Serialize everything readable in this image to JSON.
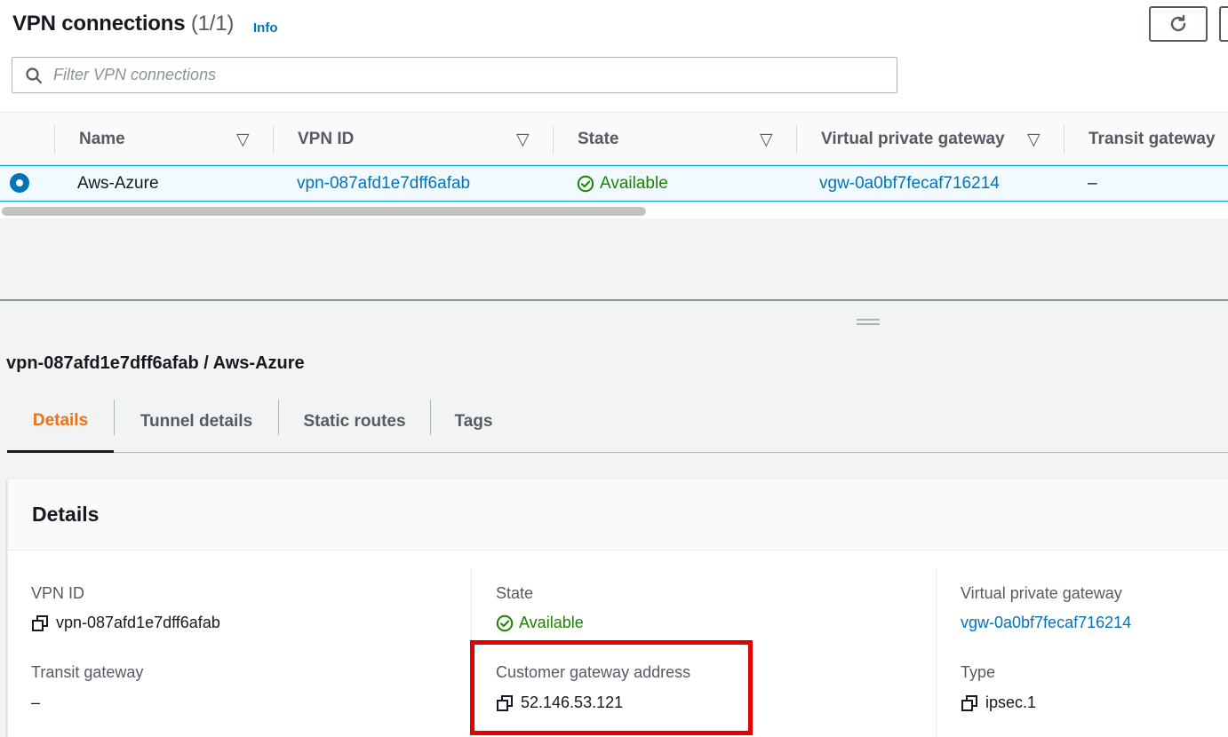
{
  "list": {
    "title": "VPN connections",
    "count": "(1/1)",
    "info_label": "Info",
    "filter_placeholder": "Filter VPN connections"
  },
  "table": {
    "columns": [
      "Name",
      "VPN ID",
      "State",
      "Virtual private gateway",
      "Transit gateway"
    ],
    "rows": [
      {
        "name": "Aws-Azure",
        "vpn_id": "vpn-087afd1e7dff6afab",
        "state": "Available",
        "vpg": "vgw-0a0bf7fecaf716214",
        "tgw": "–"
      }
    ]
  },
  "detail": {
    "title": "vpn-087afd1e7dff6afab / Aws-Azure",
    "tabs": [
      "Details",
      "Tunnel details",
      "Static routes",
      "Tags"
    ],
    "active_tab": "Details",
    "card_title": "Details",
    "fields": {
      "vpn_id_label": "VPN ID",
      "vpn_id_value": "vpn-087afd1e7dff6afab",
      "state_label": "State",
      "state_value": "Available",
      "vpg_label": "Virtual private gateway",
      "vpg_value": "vgw-0a0bf7fecaf716214",
      "tgw_label": "Transit gateway",
      "tgw_value": "–",
      "cga_label": "Customer gateway address",
      "cga_value": "52.146.53.121",
      "type_label": "Type",
      "type_value": "ipsec.1"
    }
  },
  "icons": {
    "search": "search-icon",
    "refresh": "refresh-icon",
    "sort": "sort-caret-icon",
    "copy": "copy-icon",
    "status_ok": "check-circle-icon"
  },
  "colors": {
    "link": "#0073bb",
    "success": "#1d8102",
    "active_tab": "#ec7211",
    "highlight": "#e50000"
  }
}
